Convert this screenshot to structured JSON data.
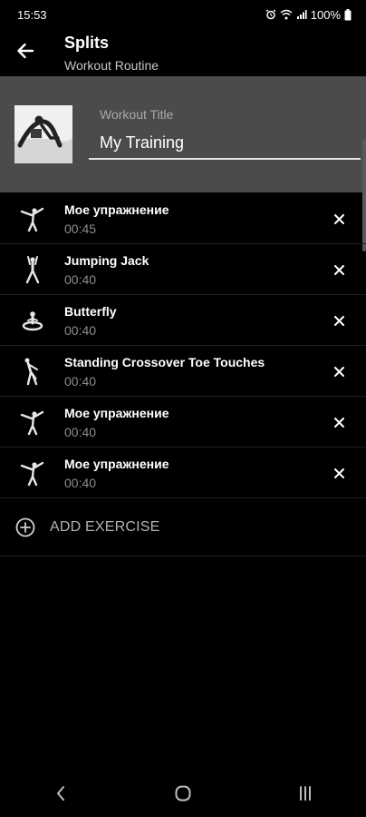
{
  "status_bar": {
    "time": "15:53",
    "battery": "100%",
    "icons": [
      "alarm-icon",
      "wifi-icon",
      "signal-icon",
      "battery-icon"
    ]
  },
  "app_bar": {
    "title": "Splits",
    "subtitle": "Workout Routine",
    "back_icon": "arrow-left-icon"
  },
  "header": {
    "title_label": "Workout Title",
    "title_value": "My Training"
  },
  "exercises": [
    {
      "name": "Мое упражнение",
      "time": "00:45",
      "icon": "stretch-pose-icon"
    },
    {
      "name": "Jumping Jack",
      "time": "00:40",
      "icon": "jumping-jack-icon"
    },
    {
      "name": "Butterfly",
      "time": "00:40",
      "icon": "butterfly-pose-icon"
    },
    {
      "name": "Standing Crossover Toe Touches",
      "time": "00:40",
      "icon": "toe-touch-icon"
    },
    {
      "name": "Мое упражнение",
      "time": "00:40",
      "icon": "stretch-pose-icon"
    },
    {
      "name": "Мое упражнение",
      "time": "00:40",
      "icon": "stretch-pose-icon"
    }
  ],
  "add_exercise": {
    "label": "ADD EXERCISE",
    "icon": "plus-circle-icon"
  },
  "nav": {
    "items": [
      "back-nav-icon",
      "home-nav-icon",
      "recents-nav-icon"
    ]
  },
  "colors": {
    "background": "#000000",
    "header_panel": "#4b4b4b",
    "secondary_text": "#8c8c8c"
  }
}
